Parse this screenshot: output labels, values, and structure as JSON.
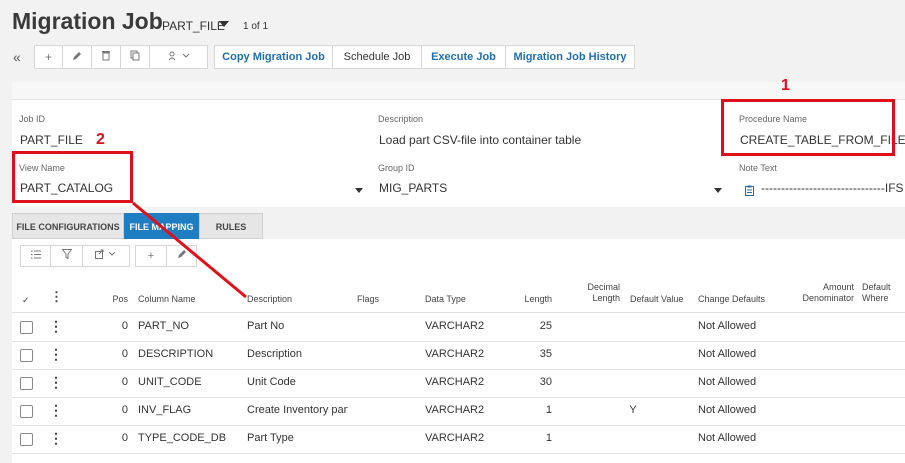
{
  "header": {
    "title": "Migration Job",
    "record_selector": "PART_FILE",
    "record_count": "1 of 1"
  },
  "toolbar": {
    "icons": [
      "collapse-icon",
      "add-icon",
      "edit-icon",
      "delete-icon",
      "duplicate-icon",
      "user-settings-icon",
      "chevron-down-icon"
    ],
    "commands": [
      "Copy Migration Job",
      "Schedule Job",
      "Execute Job",
      "Migration Job History"
    ]
  },
  "fields": {
    "job_id": {
      "label": "Job ID",
      "value": "PART_FILE"
    },
    "description": {
      "label": "Description",
      "value": "Load part CSV-file into container table"
    },
    "procedure_name": {
      "label": "Procedure Name",
      "value": "CREATE_TABLE_FROM_FILE"
    },
    "view_name": {
      "label": "View Name",
      "value": "PART_CATALOG"
    },
    "group_id": {
      "label": "Group ID",
      "value": "MIG_PARTS"
    },
    "note_text": {
      "label": "Note Text",
      "value": "-------------------------------IFS"
    }
  },
  "annotations": {
    "marker_1": "1",
    "marker_2": "2",
    "color": "#e0101a"
  },
  "tabs": [
    {
      "label": "FILE CONFIGURATIONS",
      "active": false
    },
    {
      "label": "FILE MAPPING",
      "active": true
    },
    {
      "label": "RULES",
      "active": false
    }
  ],
  "grid": {
    "columns": {
      "pos": "Pos",
      "column_name": "Column Name",
      "description": "Description",
      "flags": "Flags",
      "data_type": "Data Type",
      "length": "Length",
      "decimal_length": "Decimal Length",
      "default_value": "Default Value",
      "change_defaults": "Change Defaults",
      "amount_denominator": "Amount Denominator",
      "default_where": "Default Where"
    },
    "rows": [
      {
        "pos": "0",
        "column_name": "PART_NO",
        "description": "Part No",
        "flags": "",
        "data_type": "VARCHAR2",
        "length": "25",
        "decimal_length": "",
        "default_value": "",
        "change_defaults": "Not Allowed"
      },
      {
        "pos": "0",
        "column_name": "DESCRIPTION",
        "description": "Description",
        "flags": "",
        "data_type": "VARCHAR2",
        "length": "35",
        "decimal_length": "",
        "default_value": "",
        "change_defaults": "Not Allowed"
      },
      {
        "pos": "0",
        "column_name": "UNIT_CODE",
        "description": "Unit Code",
        "flags": "",
        "data_type": "VARCHAR2",
        "length": "30",
        "decimal_length": "",
        "default_value": "",
        "change_defaults": "Not Allowed"
      },
      {
        "pos": "0",
        "column_name": "INV_FLAG",
        "description": "Create Inventory part",
        "flags": "",
        "data_type": "VARCHAR2",
        "length": "1",
        "decimal_length": "",
        "default_value": "Y",
        "change_defaults": "Not Allowed"
      },
      {
        "pos": "0",
        "column_name": "TYPE_CODE_DB",
        "description": "Part Type",
        "flags": "",
        "data_type": "VARCHAR2",
        "length": "1",
        "decimal_length": "",
        "default_value": "",
        "change_defaults": "Not Allowed"
      }
    ]
  }
}
